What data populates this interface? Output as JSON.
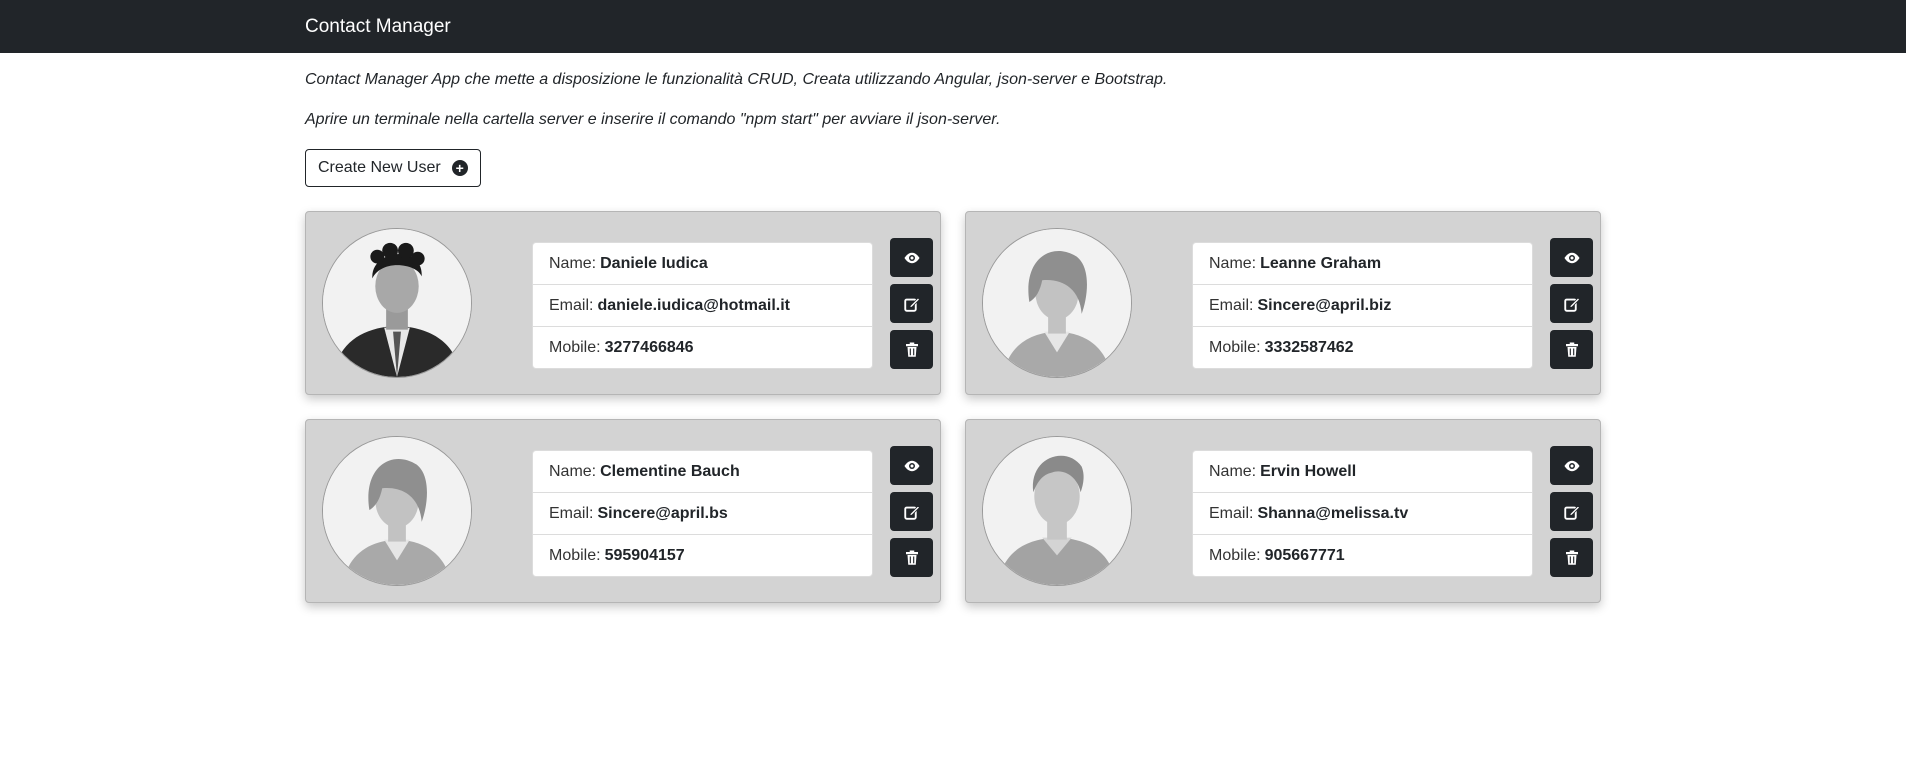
{
  "navbar": {
    "brand": "Contact Manager"
  },
  "intro": {
    "line1": "Contact Manager App che mette a disposizione le funzionalità CRUD, Creata utilizzando Angular, json-server e Bootstrap.",
    "line2": "Aprire un terminale nella cartella server e inserire il comando \"npm start\" per avviare il json-server."
  },
  "create_button": {
    "label": "Create New User",
    "icon": "plus-circle-icon"
  },
  "labels": {
    "name": "Name:",
    "email": "Email:",
    "mobile": "Mobile:"
  },
  "contacts": [
    {
      "name": "Daniele Iudica",
      "email": "daniele.iudica@hotmail.it",
      "mobile": "3277466846",
      "avatar": "photo-man-suit"
    },
    {
      "name": "Leanne Graham",
      "email": "Sincere@april.biz",
      "mobile": "3332587462",
      "avatar": "placeholder-female"
    },
    {
      "name": "Clementine Bauch",
      "email": "Sincere@april.bs",
      "mobile": "595904157",
      "avatar": "placeholder-female"
    },
    {
      "name": "Ervin Howell",
      "email": "Shanna@melissa.tv",
      "mobile": "905667771",
      "avatar": "placeholder-male"
    }
  ],
  "action_icons": [
    "eye-icon",
    "edit-icon",
    "trash-icon"
  ],
  "colors": {
    "navbar_bg": "#212529",
    "card_bg": "#d3d3d3",
    "button_dark": "#212529"
  }
}
